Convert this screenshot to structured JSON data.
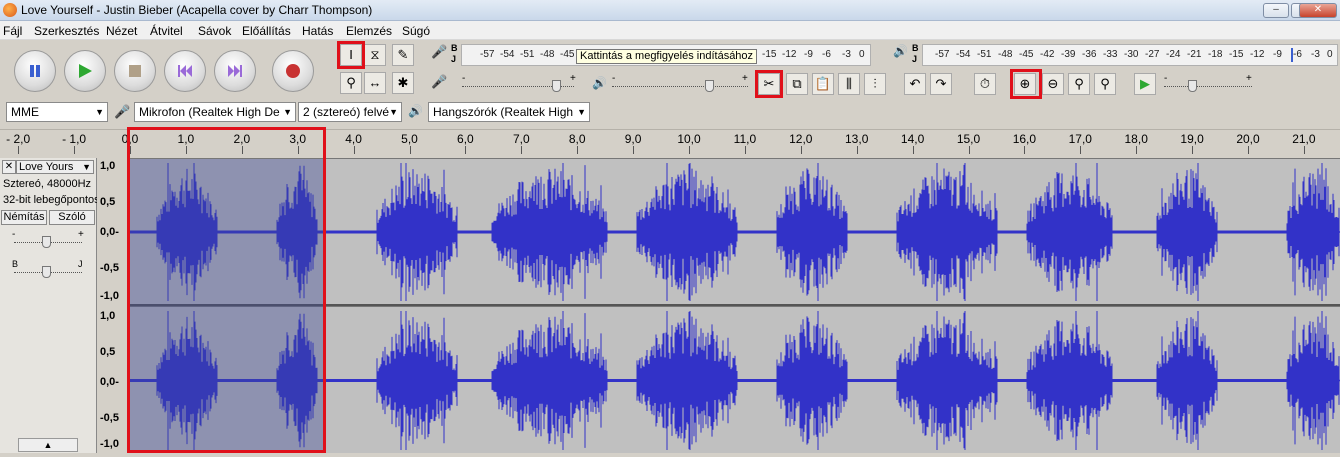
{
  "window": {
    "title": "Love Yourself - Justin Bieber (Acapella cover by Charr Thompson)"
  },
  "menu": [
    "Fájl",
    "Szerkesztés",
    "Nézet",
    "Átvitel",
    "Sávok",
    "Előállítás",
    "Hatás",
    "Elemzés",
    "Súgó"
  ],
  "transport": {
    "pause_icon": "pause-icon",
    "play_icon": "play-icon",
    "stop_icon": "stop-icon",
    "skip_start_icon": "skip-start-icon",
    "skip_end_icon": "skip-end-icon",
    "record_icon": "record-icon"
  },
  "meters": {
    "record_ticks": [
      "-57",
      "-54",
      "-51",
      "-48",
      "-45",
      "-15",
      "-12",
      "-9",
      "-6",
      "-3",
      "0"
    ],
    "tooltip": "Kattintás a megfigyelés indításához",
    "play_ticks": [
      "-57",
      "-54",
      "-51",
      "-48",
      "-45",
      "-42",
      "-39",
      "-36",
      "-33",
      "-30",
      "-27",
      "-24",
      "-21",
      "-18",
      "-15",
      "-12",
      "-9",
      "-6",
      "-3",
      "0"
    ],
    "lr_left": "B",
    "lr_right": "J"
  },
  "devices": {
    "host": "MME",
    "mic": "Mikrofon (Realtek High De",
    "channels": "2 (sztereó) felvé",
    "speaker": "Hangszórók (Realtek High"
  },
  "timeline": [
    "- 2,0",
    "- 1,0",
    "0,0",
    "1,0",
    "2,0",
    "3,0",
    "4,0",
    "5,0",
    "6,0",
    "7,0",
    "8,0",
    "9,0",
    "10,0",
    "11,0",
    "12,0",
    "13,0",
    "14,0",
    "15,0",
    "16,0",
    "17,0",
    "18,0",
    "19,0",
    "20,0",
    "21,0"
  ],
  "track": {
    "name": "Love Yours",
    "info1": "Sztereó, 48000Hz",
    "info2": "32-bit lebegőpontos",
    "mute": "Némítás",
    "solo": "Szóló",
    "gain_minus": "-",
    "gain_plus": "+",
    "pan_left": "B",
    "pan_right": "J"
  },
  "vscale": [
    "1,0",
    "0,5",
    "0,0-",
    "-0,5",
    "-1,0"
  ],
  "colors": {
    "waveform": "#3232c8",
    "selection": "#3c4696",
    "highlight": "#e0101a"
  }
}
